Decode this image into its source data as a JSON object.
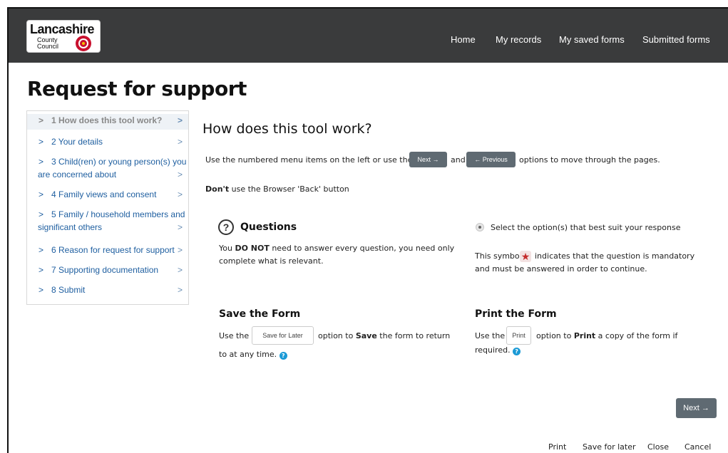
{
  "brand": {
    "logo_title": "Lancashire",
    "logo_sub1": "County",
    "logo_sub2": "Council"
  },
  "nav": {
    "items": [
      "Home",
      "My records",
      "My saved forms",
      "Submitted forms"
    ]
  },
  "page": {
    "title": "Request for support"
  },
  "sidebar": {
    "items": [
      {
        "label": "1 How does this tool work?"
      },
      {
        "label": "2 Your details"
      },
      {
        "label_line1": "3 Child(ren) or young person(s) you",
        "label_line2": "are concerned about"
      },
      {
        "label": "4 Family views and consent"
      },
      {
        "label_line1": "5 Family / household members and",
        "label_line2": "significant others"
      },
      {
        "label": "6 Reason for request for support"
      },
      {
        "label": "7 Supporting documentation"
      },
      {
        "label": "8 Submit"
      }
    ]
  },
  "main": {
    "heading": "How does this tool work?",
    "intro_before": "Use the numbered menu items on the left or use the",
    "next_label": "Next →",
    "intro_and": "and",
    "previous_label": "← Previous",
    "intro_after": "options to move through the pages.",
    "dont_bold": "Don't",
    "dont_rest": " use the Browser 'Back' button",
    "questions": {
      "heading": "Questions",
      "line1_pre": "You ",
      "line1_bold": "DO NOT",
      "line1_post": " need to answer every question, you need only",
      "line2": "complete what is relevant."
    },
    "select": {
      "text": "Select the option(s) that best suit your response",
      "symbol_pre": "This symbol",
      "symbol_post": "indicates that the question is mandatory",
      "line2": "and must be answered in order to continue."
    },
    "save": {
      "heading": "Save the Form",
      "pre": "Use the",
      "button": "Save for Later",
      "mid": "option to",
      "bold": "Save",
      "post": " the form to return",
      "line2": "to at any time."
    },
    "print": {
      "heading": "Print the Form",
      "pre": "Use the",
      "button": "Print",
      "mid": "option to",
      "bold": "Print",
      "post": " a copy of the form if",
      "line2": "required."
    },
    "next_button": "Next →"
  },
  "footer": {
    "links": [
      "Print",
      "Save for later",
      "Close",
      "Cancel"
    ]
  }
}
